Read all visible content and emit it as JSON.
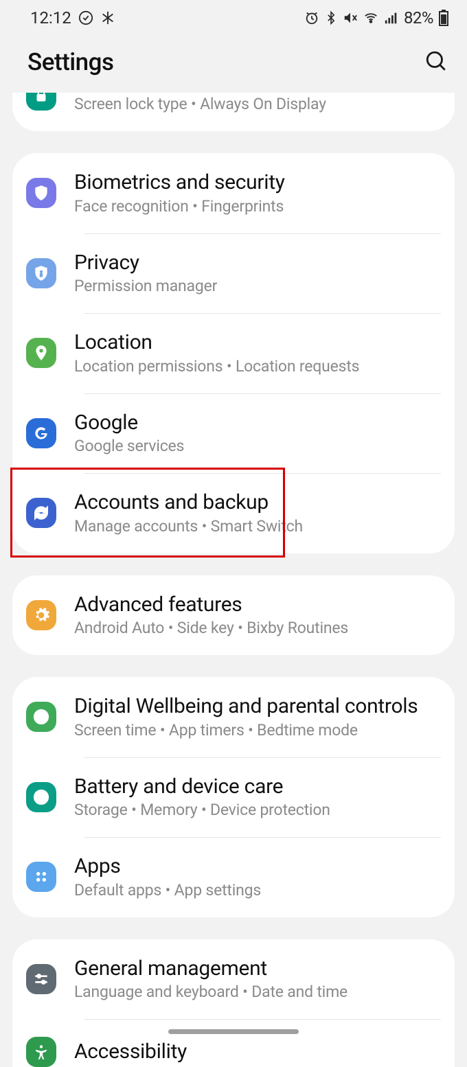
{
  "status": {
    "time": "12:12",
    "battery_pct": "82%"
  },
  "header": {
    "title": "Settings"
  },
  "groups": [
    {
      "items": [
        {
          "icon": "lock-screen",
          "bg": "#009c84",
          "title": "",
          "sub": "Screen lock type  •  Always On Display",
          "partial": true
        }
      ]
    },
    {
      "items": [
        {
          "icon": "shield",
          "bg": "#7a79e8",
          "title": "Biometrics and security",
          "sub": "Face recognition  •  Fingerprints"
        },
        {
          "icon": "privacy",
          "bg": "#76a4e8",
          "title": "Privacy",
          "sub": "Permission manager"
        },
        {
          "icon": "location",
          "bg": "#56b24f",
          "title": "Location",
          "sub": "Location permissions  •  Location requests"
        },
        {
          "icon": "google",
          "bg": "#2a6cd8",
          "title": "Google",
          "sub": "Google services"
        },
        {
          "icon": "sync",
          "bg": "#3b62cf",
          "title": "Accounts and backup",
          "sub": "Manage accounts  •  Smart Switch",
          "highlight": true
        }
      ]
    },
    {
      "items": [
        {
          "icon": "gear",
          "bg": "#f0a83a",
          "title": "Advanced features",
          "sub": "Android Auto  •  Side key  •  Bixby Routines"
        }
      ]
    },
    {
      "items": [
        {
          "icon": "wellbeing",
          "bg": "#3fab58",
          "title": "Digital Wellbeing and parental controls",
          "sub": "Screen time  •  App timers  •  Bedtime mode"
        },
        {
          "icon": "battery",
          "bg": "#0a9e87",
          "title": "Battery and device care",
          "sub": "Storage  •  Memory  •  Device protection"
        },
        {
          "icon": "apps",
          "bg": "#5ba6ec",
          "title": "Apps",
          "sub": "Default apps  •  App settings"
        }
      ]
    },
    {
      "items": [
        {
          "icon": "sliders",
          "bg": "#5f6a72",
          "title": "General management",
          "sub": "Language and keyboard  •  Date and time"
        },
        {
          "icon": "accessibility",
          "bg": "#2e9a4e",
          "title": "Accessibility",
          "sub": "",
          "partial_bottom": true
        }
      ]
    }
  ]
}
